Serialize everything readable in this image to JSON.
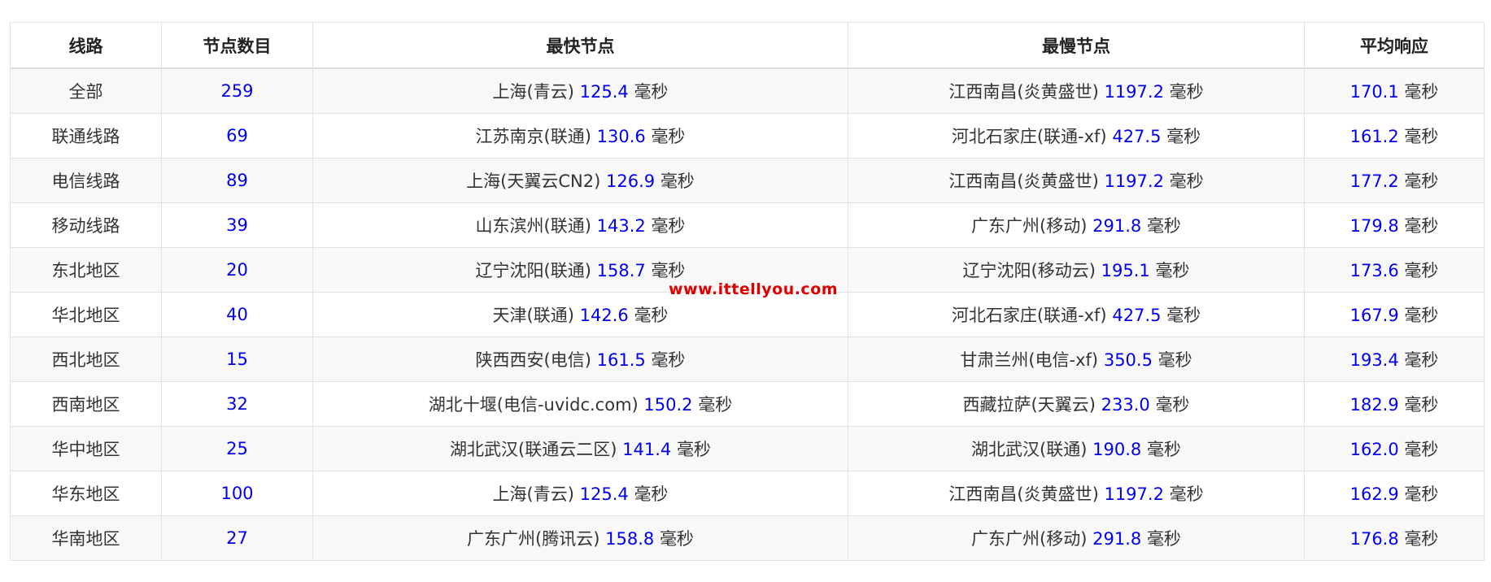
{
  "table": {
    "headers": [
      "线路",
      "节点数目",
      "最快节点",
      "最慢节点",
      "平均响应"
    ],
    "rows": [
      {
        "route": "全部",
        "count": "259",
        "fast_name": "上海(青云)",
        "fast_value": "125.4",
        "slow_name": "江西南昌(炎黄盛世)",
        "slow_value": "1197.2",
        "avg_value": "170.1"
      },
      {
        "route": "联通线路",
        "count": "69",
        "fast_name": "江苏南京(联通)",
        "fast_value": "130.6",
        "slow_name": "河北石家庄(联通-xf)",
        "slow_value": "427.5",
        "avg_value": "161.2"
      },
      {
        "route": "电信线路",
        "count": "89",
        "fast_name": "上海(天翼云CN2)",
        "fast_value": "126.9",
        "slow_name": "江西南昌(炎黄盛世)",
        "slow_value": "1197.2",
        "avg_value": "177.2"
      },
      {
        "route": "移动线路",
        "count": "39",
        "fast_name": "山东滨州(联通)",
        "fast_value": "143.2",
        "slow_name": "广东广州(移动)",
        "slow_value": "291.8",
        "avg_value": "179.8"
      },
      {
        "route": "东北地区",
        "count": "20",
        "fast_name": "辽宁沈阳(联通)",
        "fast_value": "158.7",
        "slow_name": "辽宁沈阳(移动云)",
        "slow_value": "195.1",
        "avg_value": "173.6"
      },
      {
        "route": "华北地区",
        "count": "40",
        "fast_name": "天津(联通)",
        "fast_value": "142.6",
        "slow_name": "河北石家庄(联通-xf)",
        "slow_value": "427.5",
        "avg_value": "167.9"
      },
      {
        "route": "西北地区",
        "count": "15",
        "fast_name": "陕西西安(电信)",
        "fast_value": "161.5",
        "slow_name": "甘肃兰州(电信-xf)",
        "slow_value": "350.5",
        "avg_value": "193.4"
      },
      {
        "route": "西南地区",
        "count": "32",
        "fast_name": "湖北十堰(电信-uvidc.com)",
        "fast_value": "150.2",
        "slow_name": "西藏拉萨(天翼云)",
        "slow_value": "233.0",
        "avg_value": "182.9"
      },
      {
        "route": "华中地区",
        "count": "25",
        "fast_name": "湖北武汉(联通云二区)",
        "fast_value": "141.4",
        "slow_name": "湖北武汉(联通)",
        "slow_value": "190.8",
        "avg_value": "162.0"
      },
      {
        "route": "华东地区",
        "count": "100",
        "fast_name": "上海(青云)",
        "fast_value": "125.4",
        "slow_name": "江西南昌(炎黄盛世)",
        "slow_value": "1197.2",
        "avg_value": "162.9"
      },
      {
        "route": "华南地区",
        "count": "27",
        "fast_name": "广东广州(腾讯云)",
        "fast_value": "158.8",
        "slow_name": "广东广州(移动)",
        "slow_value": "291.8",
        "avg_value": "176.8"
      }
    ]
  },
  "unit_label": "毫秒",
  "watermark": "www.ittellyou.com",
  "colors": {
    "number": "#0000ee",
    "watermark": "#e00000",
    "stripe": "#f8f8f8",
    "border": "#e3e3e3"
  }
}
